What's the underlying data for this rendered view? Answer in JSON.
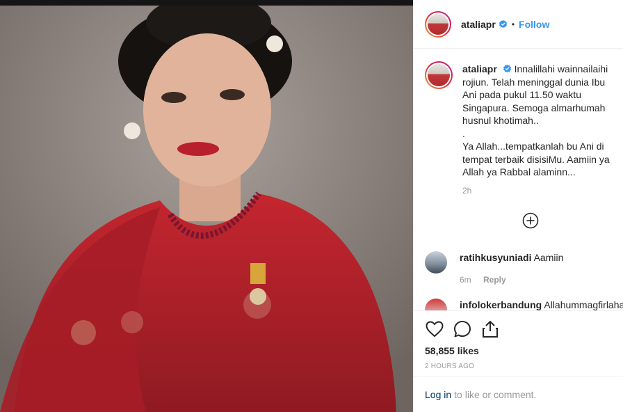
{
  "post": {
    "photo_alt": "portrait photo",
    "username": "ataliapr",
    "follow_label": "Follow",
    "dot": "•"
  },
  "caption": {
    "username": "ataliapr",
    "text": "Innalillahi wainnailaihi rojiun. Telah meninggal dunia Ibu Ani pada pukul 11.50 waktu Singapura. Semoga almarhumah husnul khotimah..\n.\nYa Allah...tempatkanlah bu Ani di tempat terbaik disisiMu. Aamiin ya Allah ya Rabbal alaminn...",
    "time": "2h"
  },
  "comments": [
    {
      "username": "ratihkusyuniadi",
      "text": "Aamiin",
      "time": "6m",
      "reply_label": "Reply"
    },
    {
      "username": "infolokerbandung",
      "text": "Allahummagfirlaha"
    }
  ],
  "actions": {
    "likes": "58,855 likes",
    "timestamp": "2 HOURS AGO"
  },
  "login_bar": {
    "login_label": "Log in",
    "suffix": "to like or comment."
  },
  "colors": {
    "link_blue": "#3897f0",
    "login_blue": "#003569",
    "muted": "#999999",
    "border": "#efefef"
  },
  "icons": [
    "verified-badge-icon",
    "load-more-comments-icon",
    "heart-icon",
    "comment-icon",
    "share-icon"
  ]
}
